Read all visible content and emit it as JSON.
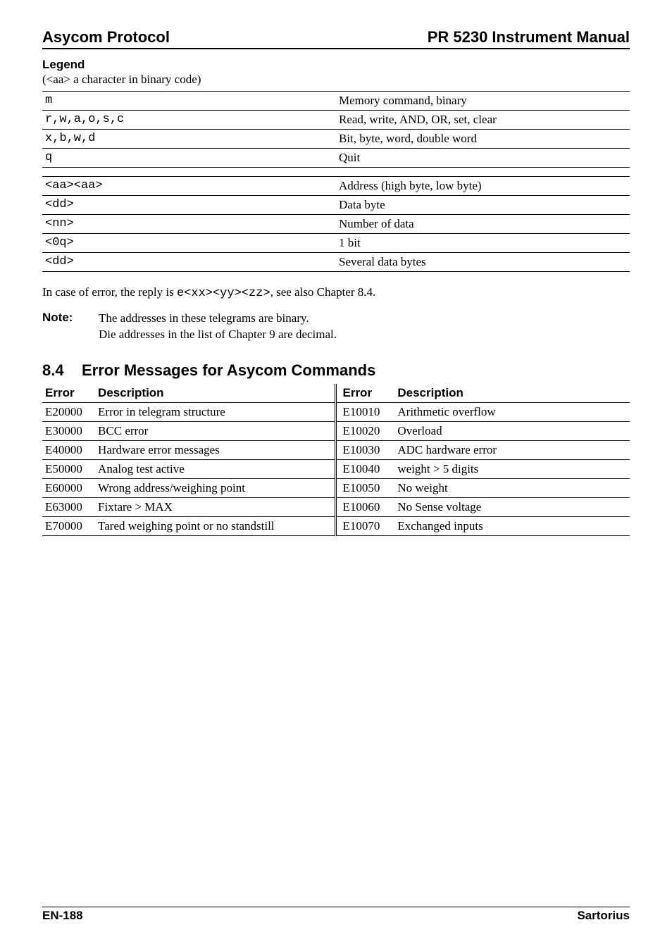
{
  "header": {
    "left": "Asycom Protocol",
    "right": "PR 5230 Instrument Manual"
  },
  "legend": {
    "title": "Legend",
    "subtitle": "(<aa> a character in binary code)",
    "rows_top": [
      {
        "code": "m",
        "desc": "Memory command, binary"
      },
      {
        "code": "r,w,a,o,s,c",
        "desc": "Read, write, AND, OR, set, clear"
      },
      {
        "code": "x,b,w,d",
        "desc": "Bit, byte, word, double word"
      },
      {
        "code": "q",
        "desc": "Quit"
      }
    ],
    "rows_bottom": [
      {
        "code": "<aa><aa>",
        "desc": "Address (high byte, low byte)"
      },
      {
        "code": "<dd>",
        "desc": "Data byte"
      },
      {
        "code": "<nn>",
        "desc": "Number of data"
      },
      {
        "code": "<0q>",
        "desc": "1 bit"
      },
      {
        "code": "<dd>",
        "desc": "Several data bytes"
      }
    ]
  },
  "error_line": {
    "prefix": "In case of error, the reply is ",
    "code": "e<xx><yy><zz>",
    "suffix": ", see also Chapter 8.4."
  },
  "note": {
    "label": "Note:",
    "line1": "The addresses in these telegrams are binary.",
    "line2": "Die addresses in the list of Chapter 9 are decimal."
  },
  "section": {
    "number": "8.4",
    "title": "Error Messages for Asycom Commands"
  },
  "error_table": {
    "headers": {
      "c1": "Error",
      "c2": "Description",
      "c3": "Error",
      "c4": "Description"
    },
    "rows": [
      {
        "c1": "E20000",
        "c2": "Error in telegram structure",
        "c3": "E10010",
        "c4": "Arithmetic overflow"
      },
      {
        "c1": "E30000",
        "c2": "BCC error",
        "c3": "E10020",
        "c4": "Overload"
      },
      {
        "c1": "E40000",
        "c2": "Hardware error messages",
        "c3": "E10030",
        "c4": "ADC hardware error"
      },
      {
        "c1": "E50000",
        "c2": "Analog test active",
        "c3": "E10040",
        "c4": "weight > 5 digits"
      },
      {
        "c1": "E60000",
        "c2": "Wrong address/weighing point",
        "c3": "E10050",
        "c4": "No weight"
      },
      {
        "c1": "E63000",
        "c2": "Fixtare > MAX",
        "c3": "E10060",
        "c4": "No Sense voltage"
      },
      {
        "c1": "E70000",
        "c2": "Tared weighing point or no standstill",
        "c3": "E10070",
        "c4": "Exchanged inputs"
      }
    ]
  },
  "footer": {
    "left": "EN-188",
    "right": "Sartorius"
  }
}
